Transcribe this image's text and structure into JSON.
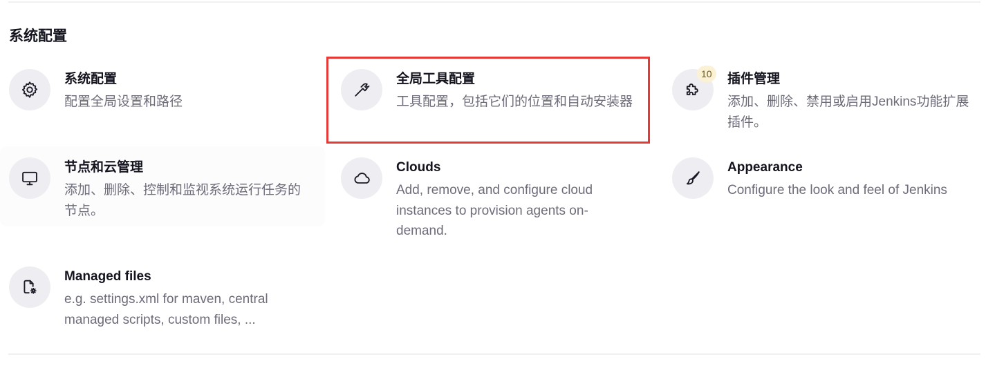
{
  "section": {
    "title": "系统配置"
  },
  "tiles": [
    {
      "title": "系统配置",
      "description": "配置全局设置和路径",
      "icon": "gear-icon"
    },
    {
      "title": "全局工具配置",
      "description": "工具配置，包括它们的位置和自动安装器",
      "icon": "hammer-icon"
    },
    {
      "title": "插件管理",
      "description": "添加、删除、禁用或启用Jenkins功能扩展插件。",
      "icon": "puzzle-icon",
      "badge": "10"
    },
    {
      "title": "节点和云管理",
      "description": "添加、删除、控制和监视系统运行任务的节点。",
      "icon": "monitor-icon"
    },
    {
      "title": "Clouds",
      "description": "Add, remove, and configure cloud instances to provision agents on-demand.",
      "icon": "cloud-icon"
    },
    {
      "title": "Appearance",
      "description": "Configure the look and feel of Jenkins",
      "icon": "paintbrush-icon"
    },
    {
      "title": "Managed files",
      "description": "e.g. settings.xml for maven, central managed scripts, custom files, ...",
      "icon": "file-gear-icon"
    }
  ],
  "colors": {
    "highlight_border": "#e53935",
    "icon_background": "#eeeef2",
    "badge_background": "#fbf2d6",
    "description_text": "#6c6c7a"
  }
}
